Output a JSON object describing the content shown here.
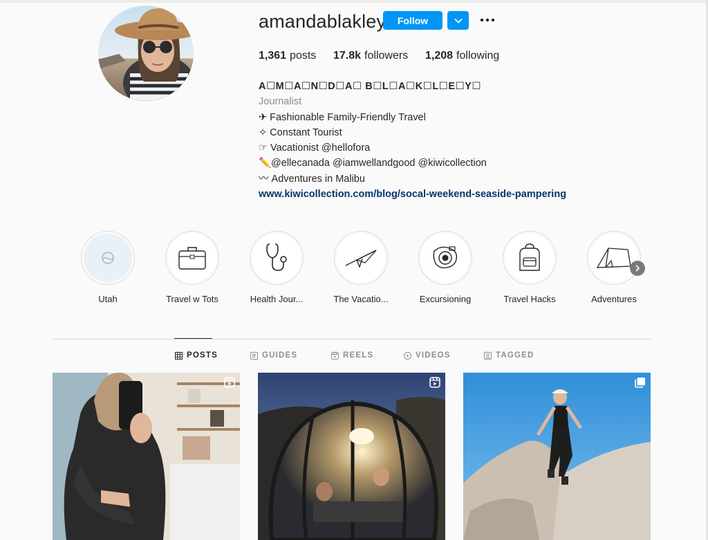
{
  "profile": {
    "username": "amandablakley",
    "follow_label": "Follow",
    "stats": {
      "posts_count": "1,361",
      "posts_label": "posts",
      "followers_count": "17.8k",
      "followers_label": "followers",
      "following_count": "1,208",
      "following_label": "following"
    },
    "bio": {
      "display_name": "A☐M☐A☐N☐D☐A☐ B☐L☐A☐K☐L☐E☐Y☐",
      "category": "Journalist",
      "lines": [
        "✈ Fashionable Family-Friendly Travel",
        "✧ Constant Tourist",
        "☞ Vacationist @hellofora",
        "✏️@ellecanada @iamwellandgood @kiwicollection",
        "〰 Adventures in Malibu"
      ],
      "link": "www.kiwicollection.com/blog/socal-weekend-seaside-pampering"
    },
    "accent_color": "#0095f6",
    "link_color": "#00376b"
  },
  "highlights": [
    {
      "label": "Utah",
      "icon": "utah-globe-icon"
    },
    {
      "label": "Travel w Tots",
      "icon": "suitcase-icon"
    },
    {
      "label": "Health Jour...",
      "icon": "stethoscope-icon"
    },
    {
      "label": "The Vacatio...",
      "icon": "paper-plane-icon"
    },
    {
      "label": "Excursioning",
      "icon": "camera-icon"
    },
    {
      "label": "Travel Hacks",
      "icon": "backpack-icon"
    },
    {
      "label": "Adventures",
      "icon": "tent-icon"
    }
  ],
  "tabs": [
    {
      "label": "POSTS",
      "icon": "grid-icon",
      "active": true
    },
    {
      "label": "GUIDES",
      "icon": "guides-icon",
      "active": false
    },
    {
      "label": "REELS",
      "icon": "reels-icon",
      "active": false
    },
    {
      "label": "VIDEOS",
      "icon": "play-icon",
      "active": false
    },
    {
      "label": "TAGGED",
      "icon": "tagged-icon",
      "active": false
    }
  ],
  "posts": [
    {
      "type": "reel",
      "badge_icon": "reel-badge-icon"
    },
    {
      "type": "reel",
      "badge_icon": "reel-badge-icon"
    },
    {
      "type": "carousel",
      "badge_icon": "carousel-badge-icon"
    }
  ]
}
